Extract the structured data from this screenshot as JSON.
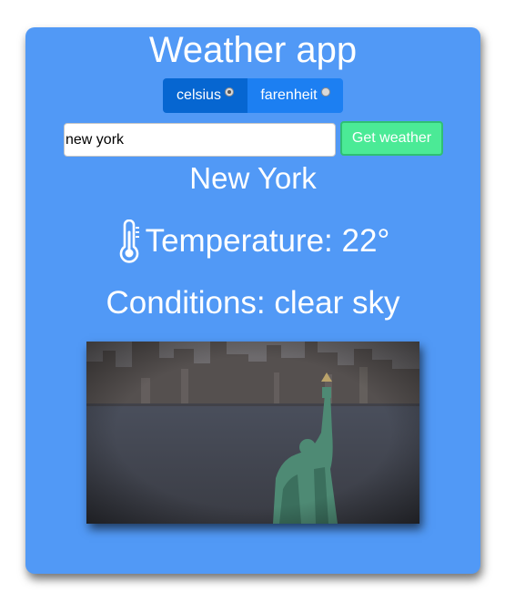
{
  "app": {
    "title": "Weather app"
  },
  "units": {
    "celsius_label": "celsius",
    "farenheit_label": "farenheit",
    "selected": "celsius"
  },
  "search": {
    "value": "new york",
    "button_label": "Get weather"
  },
  "result": {
    "city": "New York",
    "temperature_text": "Temperature: 22°",
    "conditions_text": "Conditions: clear sky"
  },
  "icons": {
    "temperature": "thermometer-icon"
  },
  "colors": {
    "card_bg": "#5199f6",
    "toggle_active": "#0666d1",
    "toggle_inactive": "#1c7ff2",
    "button_bg": "#4bea96"
  }
}
